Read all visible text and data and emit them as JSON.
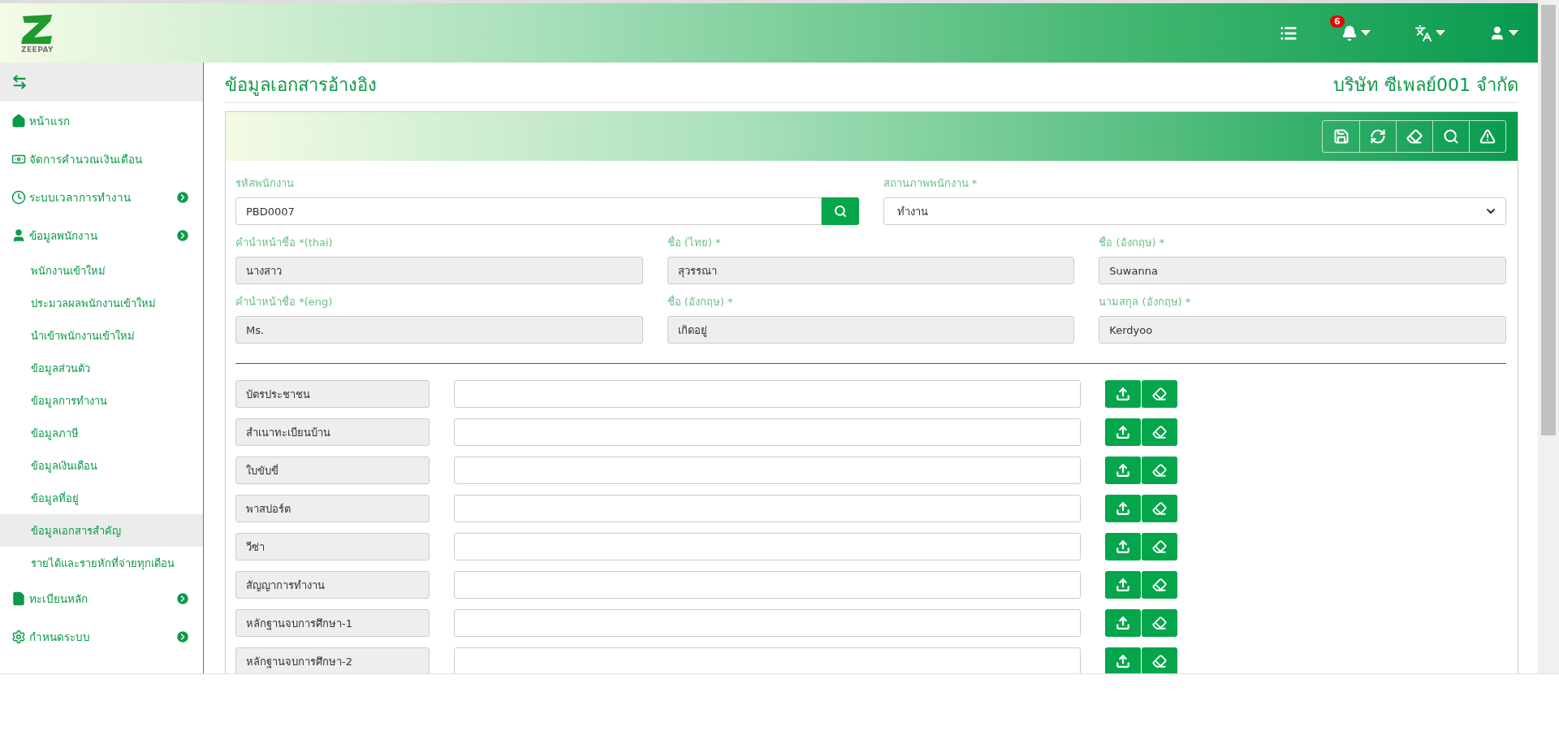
{
  "header": {
    "logo_text": "ZEEPAY",
    "notification_count": "6"
  },
  "sidebar": {
    "items": [
      {
        "label": "หน้าแรก",
        "has_submenu": false,
        "expanded": false
      },
      {
        "label": "จัดการคำนวณเงินเดือน",
        "has_submenu": false,
        "expanded": false
      },
      {
        "label": "ระบบเวลาการทำงาน",
        "has_submenu": true,
        "expanded": false
      },
      {
        "label": "ข้อมูลพนักงาน",
        "has_submenu": true,
        "expanded": true,
        "children": [
          {
            "label": "พนักงานเข้าใหม่",
            "selected": false
          },
          {
            "label": "ประมวลผลพนักงานเข้าใหม่",
            "selected": false
          },
          {
            "label": "นำเข้าพนักงานเข้าใหม่",
            "selected": false
          },
          {
            "label": "ข้อมูลส่วนตัว",
            "selected": false
          },
          {
            "label": "ข้อมูลการทำงาน",
            "selected": false
          },
          {
            "label": "ข้อมูลภาษี",
            "selected": false
          },
          {
            "label": "ข้อมูลเงินเดือน",
            "selected": false
          },
          {
            "label": "ข้อมูลที่อยู่",
            "selected": false
          },
          {
            "label": "ข้อมูลเอกสารสำคัญ",
            "selected": true
          },
          {
            "label": "รายได้และรายหักที่จ่ายทุกเดือน",
            "selected": false
          }
        ]
      },
      {
        "label": "ทะเบียนหลัก",
        "has_submenu": true,
        "expanded": false
      },
      {
        "label": "กำหนดระบบ",
        "has_submenu": true,
        "expanded": false
      }
    ]
  },
  "page": {
    "title": "ข้อมูลเอกสารอ้างอิง",
    "company": "บริษัท ซีเพลย์001 จำกัด"
  },
  "form": {
    "employee_code": {
      "label": "รหัสพนักงาน",
      "value": "PBD0007"
    },
    "status": {
      "label": "สถานภาพพนักงาน *",
      "value": "ทำงาน"
    },
    "fields": [
      {
        "label": "คำนำหน้าชื่อ *(thai)",
        "value": "นางสาว"
      },
      {
        "label": "ชื่อ (ไทย) *",
        "value": "สุวรรณา"
      },
      {
        "label": "ชื่อ (อังกฤษ) *",
        "value": "Suwanna"
      },
      {
        "label": "คำนำหน้าชื่อ *(eng)",
        "value": "Ms."
      },
      {
        "label": "ชื่อ (อังกฤษ) *",
        "value": "เกิดอยู่"
      },
      {
        "label": "นามสกุล (อังกฤษ) *",
        "value": "Kerdyoo"
      }
    ]
  },
  "documents": [
    {
      "label": "บัตรประชาชน"
    },
    {
      "label": "สำเนาทะเบียนบ้าน"
    },
    {
      "label": "ใบขับขี่"
    },
    {
      "label": "พาสปอร์ต"
    },
    {
      "label": "วีซ่า"
    },
    {
      "label": "สัญญาการทำงาน"
    },
    {
      "label": "หลักฐานจบการศึกษา-1"
    },
    {
      "label": "หลักฐานจบการศึกษา-2"
    }
  ]
}
